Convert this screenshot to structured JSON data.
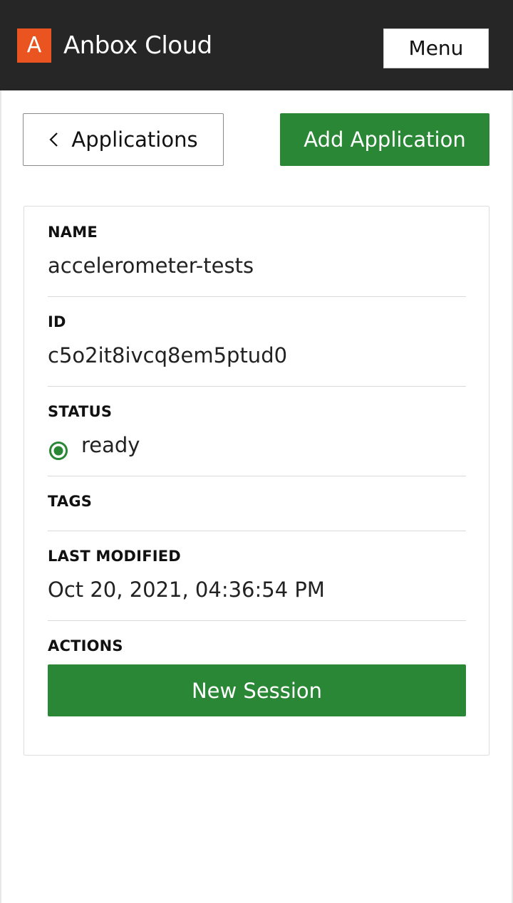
{
  "header": {
    "logo_letter": "A",
    "app_name": "Anbox Cloud",
    "menu_label": "Menu"
  },
  "toolbar": {
    "back_label": "Applications",
    "add_label": "Add Application"
  },
  "details": {
    "name_label": "NAME",
    "name_value": "accelerometer-tests",
    "id_label": "ID",
    "id_value": "c5o2it8ivcq8em5ptud0",
    "status_label": "STATUS",
    "status_value": "ready",
    "tags_label": "TAGS",
    "last_modified_label": "LAST MODIFIED",
    "last_modified_value": "Oct 20, 2021, 04:36:54 PM",
    "actions_label": "ACTIONS",
    "new_session_label": "New Session"
  },
  "colors": {
    "brand": "#e95420",
    "topbar": "#262626",
    "positive": "#2a8735",
    "status_ready": "#2a8735"
  },
  "icons": {
    "back": "chevron-left-icon",
    "status": "status-ready-icon"
  }
}
